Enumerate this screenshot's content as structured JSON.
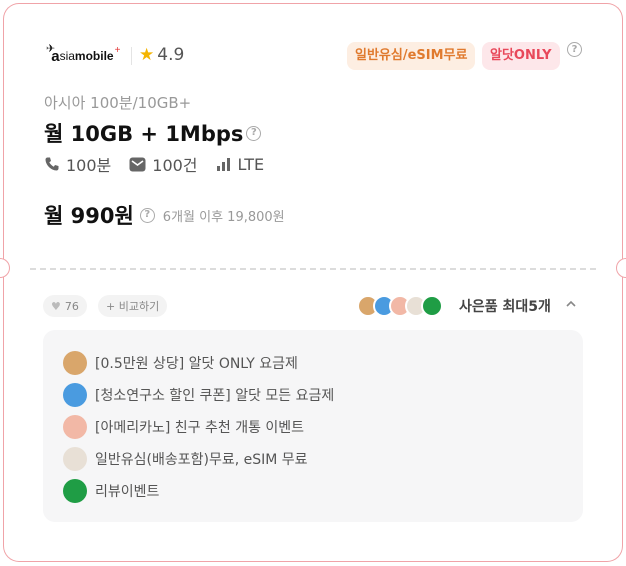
{
  "provider": {
    "logo_text_a": "a",
    "logo_text_sim": "sia",
    "logo_text_mobile": "mobile",
    "logo_plus": "+",
    "rating": "4.9"
  },
  "badges": [
    "일반유심/eSIM무료",
    "알닷ONLY"
  ],
  "plan": {
    "subtitle": "아시아 100분/10GB+",
    "title": "월 10GB + 1Mbps",
    "specs": [
      {
        "icon": "phone-icon",
        "label": "100분"
      },
      {
        "icon": "message-icon",
        "label": "100건"
      },
      {
        "icon": "signal-icon",
        "label": "LTE"
      }
    ],
    "price": "월 990원",
    "price_after": "6개월 이후 19,800원"
  },
  "actions": {
    "like_count": "76",
    "compare_label": "+ 비교하기"
  },
  "gifts": {
    "title": "사은품 최대5개",
    "items": [
      {
        "label": "[0.5만원 상당] 알닷 ONLY 요금제",
        "color": "#d9a66b"
      },
      {
        "label": "[청소연구소 할인 쿠폰] 알닷 모든 요금제",
        "color": "#4a9be0"
      },
      {
        "label": "[아메리카노] 친구 추천 개통 이벤트",
        "color": "#f2b8a6"
      },
      {
        "label": "일반유심(배송포함)무료, eSIM 무료",
        "color": "#e8e0d6"
      },
      {
        "label": "리뷰이벤트",
        "color": "#1f9d45"
      }
    ]
  },
  "colors": {
    "border": "#f0a3a8",
    "badge1_bg": "#fdeee2",
    "badge1_fg": "#e07a2e",
    "badge2_bg": "#fde7ea",
    "badge2_fg": "#e8485a",
    "star": "#f4b400"
  }
}
